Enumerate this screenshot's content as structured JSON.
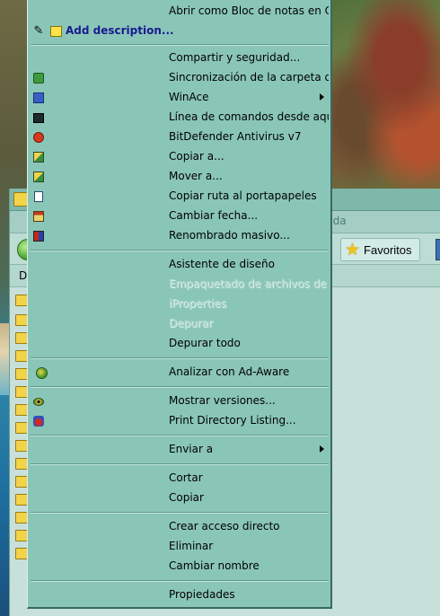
{
  "explorer": {
    "menu_partial": "uda",
    "favorites_label": "Favoritos",
    "address_label": "D"
  },
  "context_menu": {
    "items": [
      {
        "label": "Abrir como Bloc de notas en C",
        "icon": "",
        "state": "normal"
      },
      {
        "label": "Add description...",
        "icon": "pencil-icon",
        "state": "highlighted"
      },
      {
        "label": "Compartir y seguridad...",
        "icon": "",
        "state": "normal"
      },
      {
        "label": "Sincronización de la carpeta d",
        "icon": "sync-folder-icon",
        "state": "normal"
      },
      {
        "label": "WinAce",
        "icon": "winace-icon",
        "state": "submenu"
      },
      {
        "label": "Línea de comandos desde aquí",
        "icon": "command-prompt-icon",
        "state": "normal"
      },
      {
        "label": "BitDefender Antivirus v7",
        "icon": "bitdefender-icon",
        "state": "normal"
      },
      {
        "label": "Copiar a...",
        "icon": "copy-to-icon",
        "state": "normal"
      },
      {
        "label": "Mover a...",
        "icon": "move-to-icon",
        "state": "normal"
      },
      {
        "label": "Copiar ruta al portapapeles",
        "icon": "copy-path-icon",
        "state": "normal"
      },
      {
        "label": "Cambiar fecha...",
        "icon": "change-date-icon",
        "state": "normal"
      },
      {
        "label": "Renombrado masivo...",
        "icon": "bulk-rename-icon",
        "state": "normal"
      },
      {
        "label": "Asistente de diseño",
        "icon": "",
        "state": "normal"
      },
      {
        "label": "Empaquetado de archivos de A",
        "icon": "",
        "state": "disabled"
      },
      {
        "label": "iProperties",
        "icon": "",
        "state": "disabled"
      },
      {
        "label": "Depurar",
        "icon": "",
        "state": "disabled"
      },
      {
        "label": "Depurar todo",
        "icon": "",
        "state": "normal"
      },
      {
        "label": "Analizar con Ad-Aware",
        "icon": "ad-aware-icon",
        "state": "normal"
      },
      {
        "label": "Mostrar versiones...",
        "icon": "versions-icon",
        "state": "normal"
      },
      {
        "label": "Print Directory Listing...",
        "icon": "print-listing-icon",
        "state": "normal"
      },
      {
        "label": "Enviar a",
        "icon": "",
        "state": "submenu"
      },
      {
        "label": "Cortar",
        "icon": "",
        "state": "normal"
      },
      {
        "label": "Copiar",
        "icon": "",
        "state": "normal"
      },
      {
        "label": "Crear acceso directo",
        "icon": "",
        "state": "normal"
      },
      {
        "label": "Eliminar",
        "icon": "",
        "state": "normal"
      },
      {
        "label": "Cambiar nombre",
        "icon": "",
        "state": "normal"
      },
      {
        "label": "Propiedades",
        "icon": "",
        "state": "normal"
      }
    ]
  }
}
